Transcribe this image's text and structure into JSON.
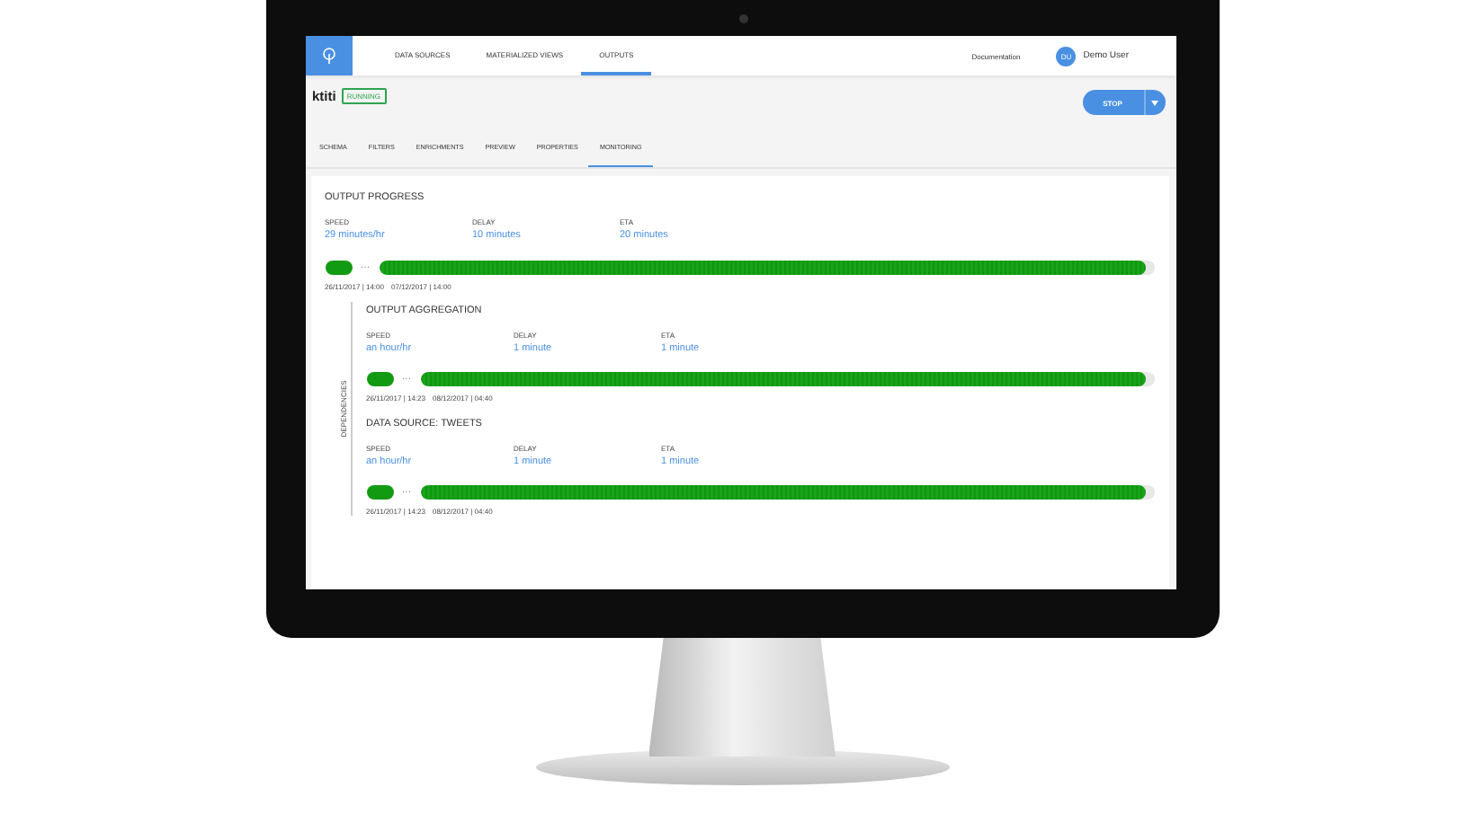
{
  "nav": {
    "items": [
      {
        "label": "DATA SOURCES",
        "selected": false
      },
      {
        "label": "MATERIALIZED VIEWS",
        "selected": false
      },
      {
        "label": "OUTPUTS",
        "selected": true
      }
    ],
    "documentation": "Documentation",
    "user": {
      "initials": "DU",
      "name": "Demo User"
    }
  },
  "output": {
    "name": "ktiti",
    "status": "RUNNING",
    "button": "STOP"
  },
  "tabs": [
    {
      "label": "SCHEMA",
      "selected": false
    },
    {
      "label": "FILTERS",
      "selected": false
    },
    {
      "label": "ENRICHMENTS",
      "selected": false
    },
    {
      "label": "PREVIEW",
      "selected": false
    },
    {
      "label": "PROPERTIES",
      "selected": false
    },
    {
      "label": "MONITORING",
      "selected": true
    }
  ],
  "progress": {
    "title": "OUTPUT PROGRESS",
    "metrics": [
      {
        "label": "SPEED",
        "value": "29 minutes/hr"
      },
      {
        "label": "DELAY",
        "value": "10 minutes"
      },
      {
        "label": "ETA",
        "value": "20 minutes"
      }
    ],
    "ellipsis": "···",
    "level": 0.99,
    "start": "26/11/2017 | 14:00",
    "end": "07/12/2017 | 14:00"
  },
  "dependencies": {
    "label": "DEPENDENCIES",
    "sections": [
      {
        "title": "OUTPUT AGGREGATION",
        "metrics": [
          {
            "label": "SPEED",
            "value": "an hour/hr"
          },
          {
            "label": "DELAY",
            "value": "1 minute"
          },
          {
            "label": "ETA",
            "value": "1 minute"
          }
        ],
        "ellipsis": "···",
        "level": 0.99,
        "start": "26/11/2017 | 14:23",
        "end": "08/12/2017 | 04:40"
      },
      {
        "title": "DATA SOURCE: TWEETS",
        "metrics": [
          {
            "label": "SPEED",
            "value": "an hour/hr"
          },
          {
            "label": "DELAY",
            "value": "1 minute"
          },
          {
            "label": "ETA",
            "value": "1 minute"
          }
        ],
        "ellipsis": "···",
        "level": 0.99,
        "start": "26/11/2017 | 14:23",
        "end": "08/12/2017 | 04:40"
      }
    ]
  }
}
